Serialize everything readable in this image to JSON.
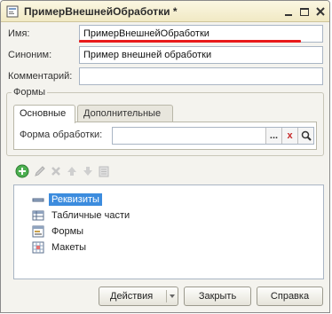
{
  "window": {
    "title": "ПримерВнешнейОбработки *",
    "colors": {
      "titlebar": "#f1e9c4",
      "underline": "#e81a1a",
      "selection": "#3c8cde"
    }
  },
  "fields": {
    "name_label": "Имя:",
    "name_value": "ПримерВнешнейОбработки",
    "synonym_label": "Синоним:",
    "synonym_value": "Пример внешней обработки",
    "comment_label": "Комментарий:",
    "comment_value": ""
  },
  "forms_group": {
    "title": "Формы",
    "tabs": [
      {
        "label": "Основные",
        "active": true
      },
      {
        "label": "Дополнительные",
        "active": false
      }
    ],
    "processing_form_label": "Форма обработки:",
    "processing_form_value": "",
    "dots_label": "...",
    "clear_label": "x"
  },
  "toolbar": {
    "icons": [
      "add-icon",
      "edit-icon",
      "delete-icon",
      "move-up-icon",
      "move-down-icon",
      "properties-icon"
    ]
  },
  "tree": {
    "items": [
      {
        "label": "Реквизиты",
        "icon": "attributes-icon",
        "selected": true
      },
      {
        "label": "Табличные части",
        "icon": "table-icon",
        "selected": false
      },
      {
        "label": "Формы",
        "icon": "form-icon",
        "selected": false
      },
      {
        "label": "Макеты",
        "icon": "template-icon",
        "selected": false
      }
    ]
  },
  "buttons": {
    "actions": "Действия",
    "close": "Закрыть",
    "help": "Справка"
  }
}
